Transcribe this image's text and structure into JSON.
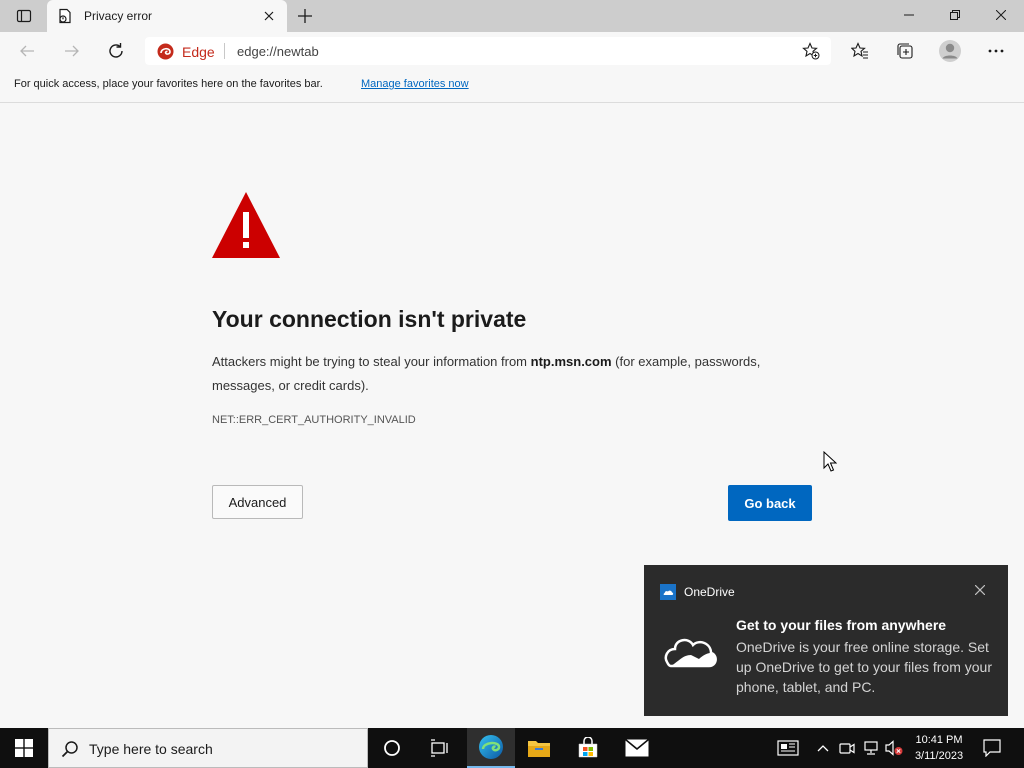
{
  "tab": {
    "title": "Privacy error"
  },
  "address": {
    "site_label": "Edge",
    "url": "edge://newtab"
  },
  "favorites_bar": {
    "message": "For quick access, place your favorites here on the favorites bar.",
    "link": "Manage favorites now"
  },
  "error_page": {
    "heading": "Your connection isn't private",
    "desc_before": "Attackers might be trying to steal your information from ",
    "desc_host": "ntp.msn.com",
    "desc_after": " (for example, passwords, messages, or credit cards).",
    "error_code": "NET::ERR_CERT_AUTHORITY_INVALID",
    "advanced_label": "Advanced",
    "go_back_label": "Go back"
  },
  "toast": {
    "app_name": "OneDrive",
    "title": "Get to your files from anywhere",
    "body": "OneDrive is your free online storage. Set up OneDrive to get to your files from your phone, tablet, and PC."
  },
  "taskbar": {
    "search_placeholder": "Type here to search",
    "time": "10:41 PM",
    "date": "3/11/2023"
  },
  "colors": {
    "accent": "#0067c0",
    "warning_red": "#cc0000",
    "edge_red": "#c42b1c",
    "taskbar": "#0f0f0f",
    "toast_bg": "#2b2b2b"
  }
}
